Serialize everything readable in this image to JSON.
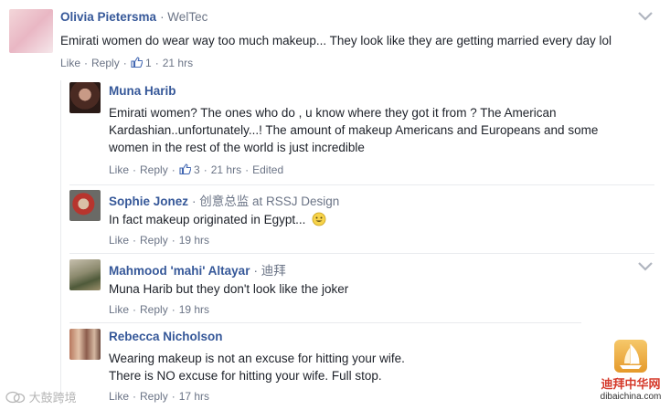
{
  "comments": [
    {
      "name": "Olivia Pietersma",
      "extra": "· WelTec",
      "text": [
        "Emirati women do wear way too much makeup... They look like they are getting married every day lol"
      ],
      "meta": {
        "like": "Like",
        "reply": "Reply",
        "reactions": "1",
        "time": "21 hrs"
      }
    },
    {
      "name": "Muna Harib",
      "extra": "",
      "text": [
        "Emirati women? The ones who do , u know where they got it from ? The American",
        "Kardashian..unfortunately...! The amount of makeup Americans and Europeans and some",
        "women in the rest of the world is just incredible"
      ],
      "meta": {
        "like": "Like",
        "reply": "Reply",
        "reactions": "3",
        "time": "21 hrs",
        "edited": "Edited"
      }
    },
    {
      "name": "Sophie Jonez",
      "extra": "· 创意总监 at RSSJ Design",
      "text": [
        "In fact makeup originated in Egypt..."
      ],
      "meta": {
        "like": "Like",
        "reply": "Reply",
        "time": "19 hrs"
      }
    },
    {
      "name": "Mahmood 'mahi' Altayar",
      "extra": "· 迪拜",
      "text": [
        "Muna Harib but they don't look like the joker"
      ],
      "meta": {
        "like": "Like",
        "reply": "Reply",
        "time": "19 hrs"
      }
    },
    {
      "name": "Rebecca Nicholson",
      "extra": "",
      "text": [
        "Wearing makeup is not an excuse for hitting your wife.",
        "There is NO excuse for hitting your wife. Full stop."
      ],
      "meta": {
        "like": "Like",
        "reply": "Reply",
        "time": "17 hrs"
      }
    }
  ],
  "watermarks": {
    "left": "大鼓跨境",
    "right_cn": "迪拜中华网",
    "right_domain": "dibaichina.com"
  },
  "colors": {
    "name": "#365899",
    "text": "#1d2129",
    "meta": "#6b7486",
    "like_icon": "#4267b2"
  }
}
